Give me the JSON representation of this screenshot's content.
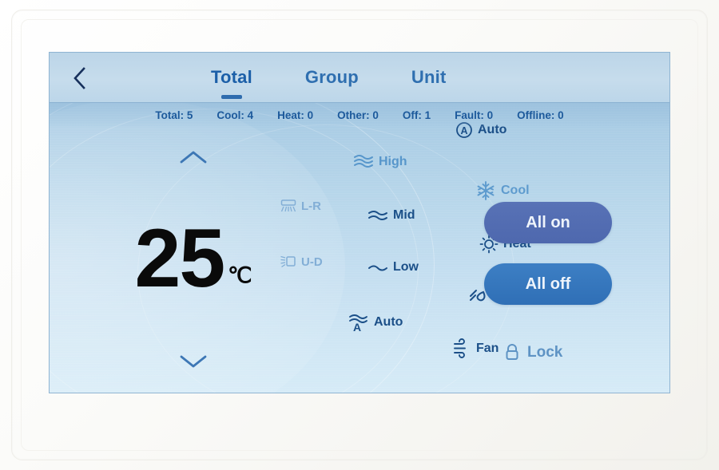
{
  "device": {
    "type": "hvac-touch-controller",
    "screen_background_top": "#9dc2e0",
    "screen_background_bottom": "#d6ebf7"
  },
  "header": {
    "back_icon": "chevron-left-icon",
    "tabs": [
      {
        "label": "Total",
        "active": true
      },
      {
        "label": "Group",
        "active": false
      },
      {
        "label": "Unit",
        "active": false
      }
    ],
    "active_tab_color": "#1b5fa8"
  },
  "status": {
    "items": [
      {
        "label": "Total",
        "value": "5",
        "text": "Total: 5"
      },
      {
        "label": "Cool",
        "value": "4",
        "text": "Cool: 4"
      },
      {
        "label": "Heat",
        "value": "0",
        "text": "Heat: 0"
      },
      {
        "label": "Other",
        "value": "0",
        "text": "Other: 0"
      },
      {
        "label": "Off",
        "value": "1",
        "text": "Off: 1"
      },
      {
        "label": "Fault",
        "value": "0",
        "text": "Fault: 0"
      },
      {
        "label": "Offline",
        "value": "0",
        "text": "Offline: 0"
      }
    ]
  },
  "temperature": {
    "value": "25",
    "unit": "℃",
    "up_icon": "chevron-up-icon",
    "down_icon": "chevron-down-icon"
  },
  "swing": {
    "items": [
      {
        "label": "L-R",
        "icon": "swing-left-right-icon",
        "enabled": false
      },
      {
        "label": "U-D",
        "icon": "swing-up-down-icon",
        "enabled": false
      }
    ]
  },
  "fan_speed": {
    "selected": "High",
    "items": [
      {
        "label": "High",
        "icon": "fan-high-icon",
        "selected": true
      },
      {
        "label": "Mid",
        "icon": "fan-mid-icon",
        "selected": false
      },
      {
        "label": "Low",
        "icon": "fan-low-icon",
        "selected": false
      },
      {
        "label": "Auto",
        "icon": "fan-auto-icon",
        "selected": false
      }
    ]
  },
  "mode": {
    "selected": "Cool",
    "items": [
      {
        "label": "Auto",
        "icon": "mode-auto-icon",
        "selected": false
      },
      {
        "label": "Cool",
        "icon": "snowflake-icon",
        "selected": true
      },
      {
        "label": "Heat",
        "icon": "sun-icon",
        "selected": false
      },
      {
        "label": "Dry",
        "icon": "dry-icon",
        "selected": false
      },
      {
        "label": "Fan",
        "icon": "wind-icon",
        "selected": false
      }
    ]
  },
  "actions": {
    "all_on_label": "All on",
    "all_off_label": "All off",
    "all_on_color": "#4e68ae",
    "all_off_color": "#2f6fb6",
    "lock_label": "Lock",
    "lock_icon": "padlock-icon"
  }
}
